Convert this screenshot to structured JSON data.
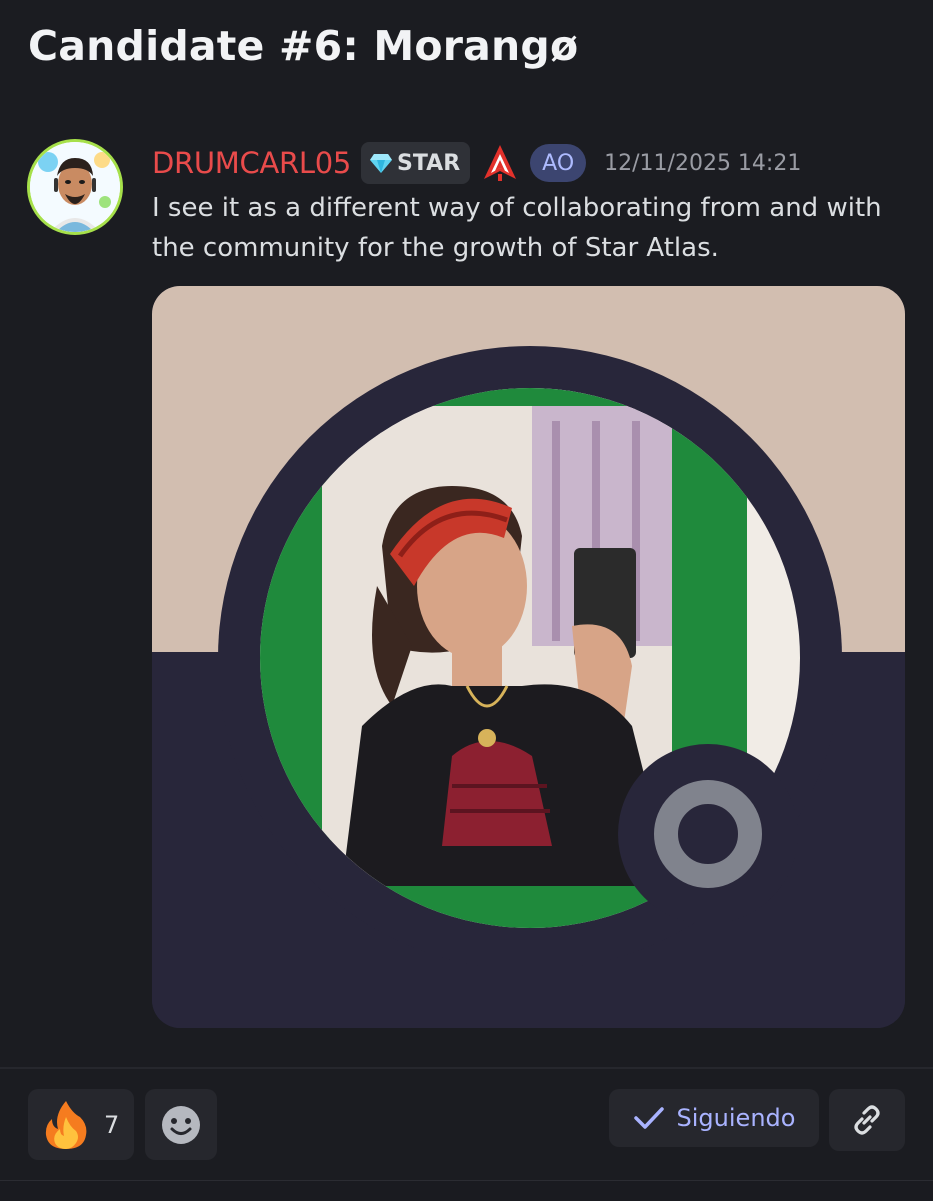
{
  "thread": {
    "title": "Candidate #6: Morangø"
  },
  "message": {
    "username": "DRUMCARL05",
    "guild_tag": "STAR",
    "guild_tag_icon": "diamond-icon",
    "role_icon": "star-atlas-logo-icon",
    "role_badge": "AO",
    "timestamp": "12/11/2025 14:21",
    "text": "I see it as a different way of collaborating from and with the community for the growth of Star Atlas.",
    "colors": {
      "username": "#e94b4b",
      "role_badge_bg": "#3c4570",
      "embed_top": "#d2beb0",
      "embed_bottom": "#28263a",
      "frame_green": "#1f8a3c"
    }
  },
  "actions": {
    "reaction_emoji": "fire-icon",
    "reaction_count": "7",
    "add_reaction_icon": "smiley-icon",
    "follow_label": "Siguiendo",
    "follow_icon": "check-icon",
    "link_icon": "link-icon"
  }
}
